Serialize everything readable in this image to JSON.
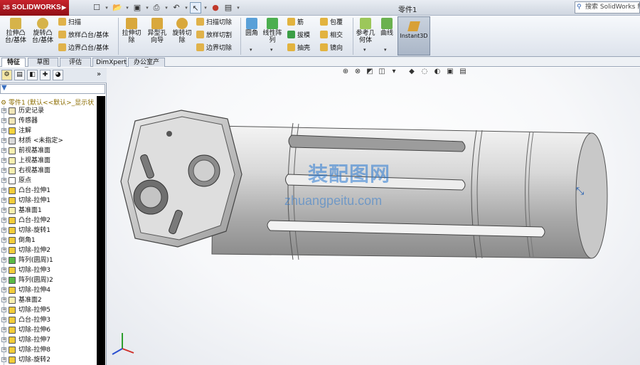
{
  "app": {
    "logo": "SOLIDWORKS",
    "doc_title": "零件1",
    "help_search": "搜索 SolidWorks 帮助"
  },
  "quick_access": {
    "icons": [
      "new-icon",
      "open-icon",
      "save-icon",
      "print-icon",
      "undo-icon",
      "select-icon",
      "rebuild-icon",
      "options-icon"
    ]
  },
  "cmd": {
    "extrude_boss": "拉伸凸台/基体",
    "revolve_boss": "旋转凸台/基体",
    "sweep": "扫描",
    "loft": "放样凸台/基体",
    "boundary_boss": "边界凸台/基体",
    "extrude_cut": "拉伸切除",
    "hole_wizard": "异型孔向导",
    "revolve_cut": "旋转切除",
    "swept_cut": "扫描切除",
    "lofted_cut": "放样切割",
    "boundary_cut": "边界切除",
    "fillet": "圆角",
    "linear_pattern": "线性阵列",
    "rib": "筋",
    "draft": "拔模",
    "shell": "抽壳",
    "wrap": "包覆",
    "intersect": "相交",
    "mirror": "镜向",
    "ref_geometry": "参考几何体",
    "curves": "曲线",
    "instant3d": "Instant3D"
  },
  "tabs": [
    {
      "label": "特征",
      "active": true
    },
    {
      "label": "草图",
      "active": false
    },
    {
      "label": "评估",
      "active": false
    },
    {
      "label": "DimXpert",
      "active": false
    },
    {
      "label": "办公室产品",
      "active": false
    }
  ],
  "tree": {
    "root": "零件1 (默认<<默认>_显示状",
    "items": [
      {
        "label": "历史记录",
        "color": "#f0e6b8"
      },
      {
        "label": "传感器",
        "color": "#f0e6b8"
      },
      {
        "label": "注解",
        "color": "#f4d23c"
      },
      {
        "label": "材质 <未指定>",
        "color": "#d9d9d9"
      },
      {
        "label": "前视基准面",
        "color": "#f6efb0"
      },
      {
        "label": "上视基准面",
        "color": "#f6efb0"
      },
      {
        "label": "右视基准面",
        "color": "#f6efb0"
      },
      {
        "label": "原点",
        "color": "#ffffff"
      },
      {
        "label": "凸台-拉伸1",
        "color": "#f2cc3a"
      },
      {
        "label": "切除-拉伸1",
        "color": "#f2cc3a"
      },
      {
        "label": "基准面1",
        "color": "#f6efb0"
      },
      {
        "label": "凸台-拉伸2",
        "color": "#f2cc3a"
      },
      {
        "label": "切除-旋转1",
        "color": "#f2cc3a"
      },
      {
        "label": "倒角1",
        "color": "#f2cc3a"
      },
      {
        "label": "切除-拉伸2",
        "color": "#f2cc3a"
      },
      {
        "label": "阵列(圆周)1",
        "color": "#58b846"
      },
      {
        "label": "切除-拉伸3",
        "color": "#f2cc3a"
      },
      {
        "label": "阵列(圆周)2",
        "color": "#58b846"
      },
      {
        "label": "切除-拉伸4",
        "color": "#f2cc3a"
      },
      {
        "label": "基准面2",
        "color": "#f6efb0"
      },
      {
        "label": "切除-拉伸5",
        "color": "#f2cc3a"
      },
      {
        "label": "凸台-拉伸3",
        "color": "#f2cc3a"
      },
      {
        "label": "切除-拉伸6",
        "color": "#f2cc3a"
      },
      {
        "label": "切除-拉伸7",
        "color": "#f2cc3a"
      },
      {
        "label": "切除-拉伸8",
        "color": "#f2cc3a"
      },
      {
        "label": "切除-旋转2",
        "color": "#f2cc3a"
      }
    ]
  },
  "watermark": {
    "text": "装配图网",
    "url": "zhuangpeitu.com"
  },
  "colors": {
    "accent": "#2a5db0",
    "logo_red": "#b01d25",
    "watermark_blue": "#2878d2"
  }
}
